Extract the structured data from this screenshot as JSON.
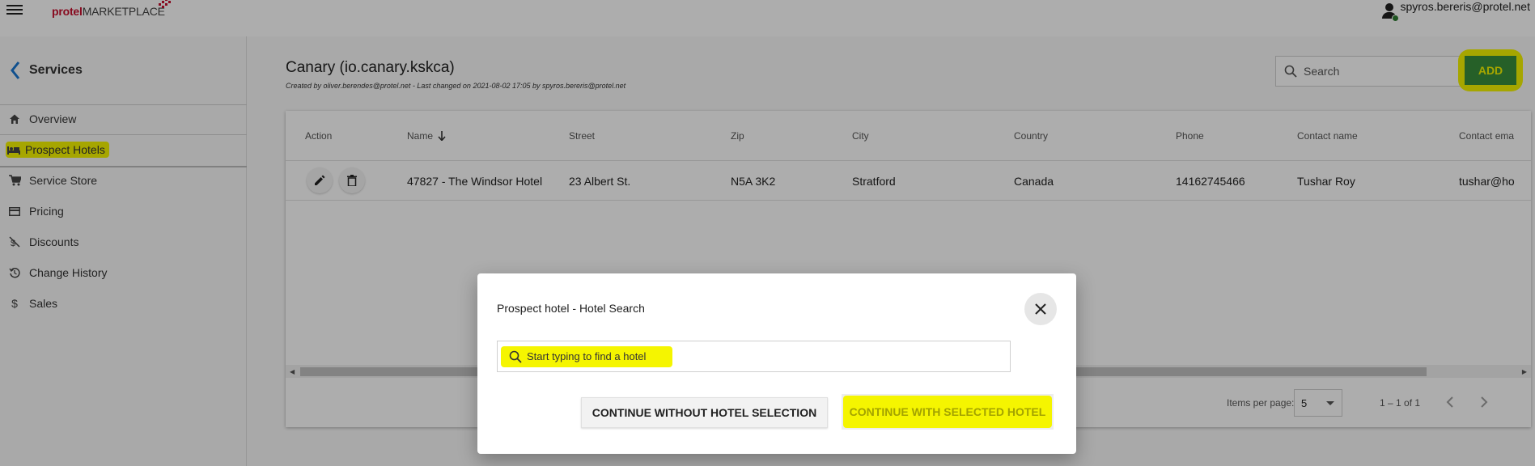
{
  "topbar": {
    "logo_bold": "protel",
    "logo_rest": "MARKETPLACE",
    "user_email": "spyros.bereris@protel.net"
  },
  "sidebar": {
    "back_label": "Services",
    "items": [
      {
        "label": "Overview",
        "icon": "home-icon"
      },
      {
        "label": "Prospect Hotels",
        "icon": "hotel-bed-icon",
        "active": true
      },
      {
        "label": "Service Store",
        "icon": "cart-icon"
      },
      {
        "label": "Pricing",
        "icon": "credit-card-icon"
      },
      {
        "label": "Discounts",
        "icon": "discount-icon"
      },
      {
        "label": "Change History",
        "icon": "history-icon"
      },
      {
        "label": "Sales",
        "icon": "dollar-icon"
      }
    ]
  },
  "header": {
    "title": "Canary (io.canary.kskca)",
    "subtitle": "Created by oliver.berendes@protel.net - Last changed on 2021-08-02 17:05 by spyros.bereris@protel.net",
    "search_placeholder": "Search",
    "add_label": "ADD"
  },
  "table": {
    "columns": [
      "Action",
      "Name",
      "Street",
      "Zip",
      "City",
      "Country",
      "Phone",
      "Contact name",
      "Contact ema"
    ],
    "rows": [
      {
        "name": "47827 - The Windsor Hotel",
        "street": "23 Albert St.",
        "zip": "N5A 3K2",
        "city": "Stratford",
        "country": "Canada",
        "phone": "14162745466",
        "contact_name": "Tushar Roy",
        "contact_email": "tushar@ho"
      }
    ],
    "paginator": {
      "items_per_page_label": "Items per page:",
      "items_per_page_value": "5",
      "range_label": "1 – 1 of 1"
    }
  },
  "dialog": {
    "title": "Prospect hotel - Hotel Search",
    "input_placeholder": "Start typing to find a hotel",
    "continue_without_label": "CONTINUE WITHOUT HOTEL SELECTION",
    "continue_with_label": "CONTINUE WITH SELECTED HOTEL"
  },
  "colors": {
    "highlight": "#f5f500",
    "add_button": "#388e3c",
    "brand_red": "#c8102e"
  }
}
